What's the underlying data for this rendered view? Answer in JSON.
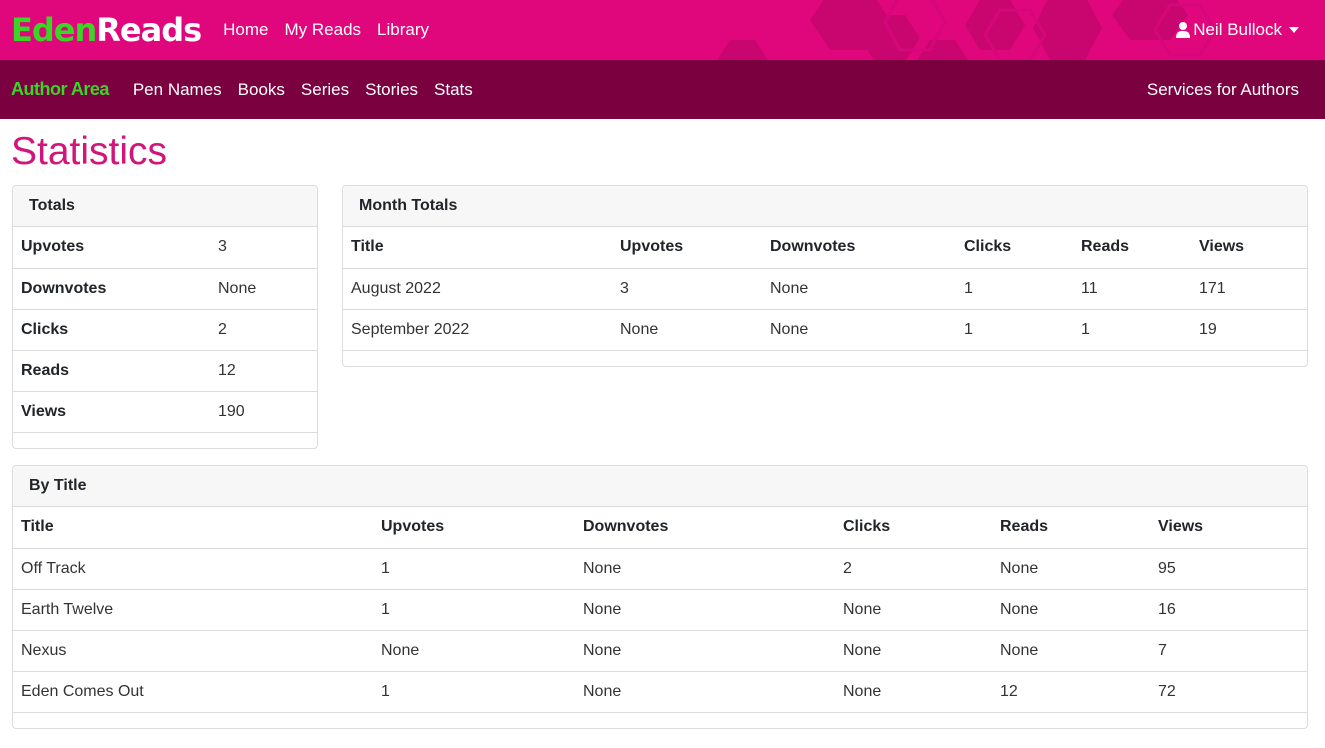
{
  "brand": {
    "part1": "Eden",
    "part2": "Reads"
  },
  "topnav": [
    {
      "label": "Home"
    },
    {
      "label": "My Reads"
    },
    {
      "label": "Library"
    }
  ],
  "user": {
    "name": "Neil Bullock"
  },
  "author_area": {
    "title": "Author Area",
    "nav": [
      {
        "label": "Pen Names"
      },
      {
        "label": "Books"
      },
      {
        "label": "Series"
      },
      {
        "label": "Stories"
      },
      {
        "label": "Stats"
      }
    ],
    "services": "Services for Authors"
  },
  "page_title": "Statistics",
  "totals": {
    "header": "Totals",
    "rows": [
      {
        "label": "Upvotes",
        "value": "3"
      },
      {
        "label": "Downvotes",
        "value": "None"
      },
      {
        "label": "Clicks",
        "value": "2"
      },
      {
        "label": "Reads",
        "value": "12"
      },
      {
        "label": "Views",
        "value": "190"
      }
    ]
  },
  "month_totals": {
    "header": "Month Totals",
    "columns": [
      "Title",
      "Upvotes",
      "Downvotes",
      "Clicks",
      "Reads",
      "Views"
    ],
    "rows": [
      [
        "August 2022",
        "3",
        "None",
        "1",
        "11",
        "171"
      ],
      [
        "September 2022",
        "None",
        "None",
        "1",
        "1",
        "19"
      ]
    ]
  },
  "by_title": {
    "header": "By Title",
    "columns": [
      "Title",
      "Upvotes",
      "Downvotes",
      "Clicks",
      "Reads",
      "Views"
    ],
    "rows": [
      [
        "Off Track",
        "1",
        "None",
        "2",
        "None",
        "95"
      ],
      [
        "Earth Twelve",
        "1",
        "None",
        "None",
        "None",
        "16"
      ],
      [
        "Nexus",
        "None",
        "None",
        "None",
        "None",
        "7"
      ],
      [
        "Eden Comes Out",
        "1",
        "None",
        "None",
        "12",
        "72"
      ]
    ]
  },
  "colors": {
    "primary": "#e0077d",
    "author_bar": "#7b0040",
    "accent_green": "#39d626",
    "title_pink": "#d1157b"
  },
  "icons": {
    "user": "user-icon",
    "caret": "caret-down-icon"
  }
}
